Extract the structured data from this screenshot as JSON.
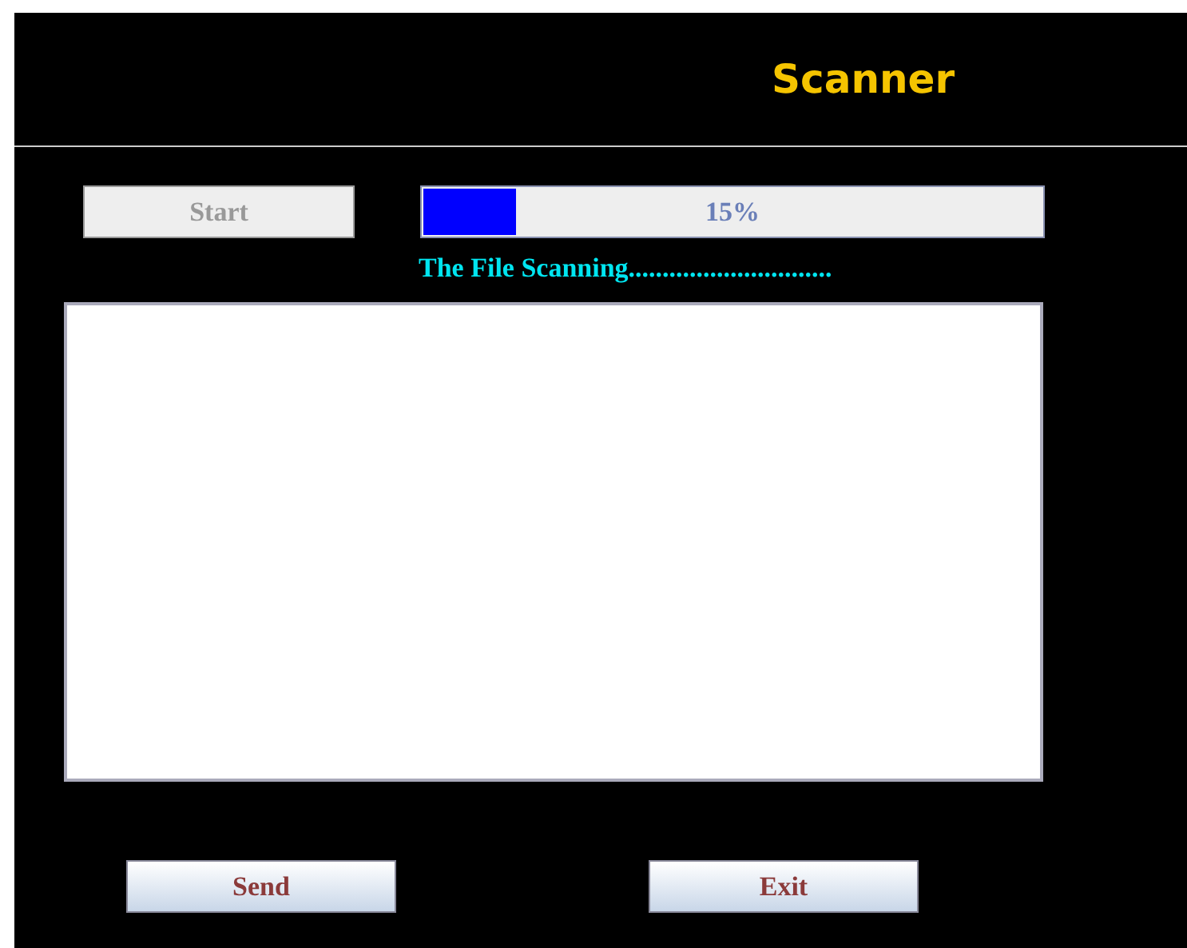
{
  "window": {
    "title": "Scanner"
  },
  "start_button": {
    "label": "Start",
    "disabled": true
  },
  "progress": {
    "level": 0.15,
    "reading": "15%"
  },
  "status": "The File Scanning..............................",
  "buttons": [
    {
      "label": "Send"
    },
    {
      "label": "Exit"
    }
  ]
}
